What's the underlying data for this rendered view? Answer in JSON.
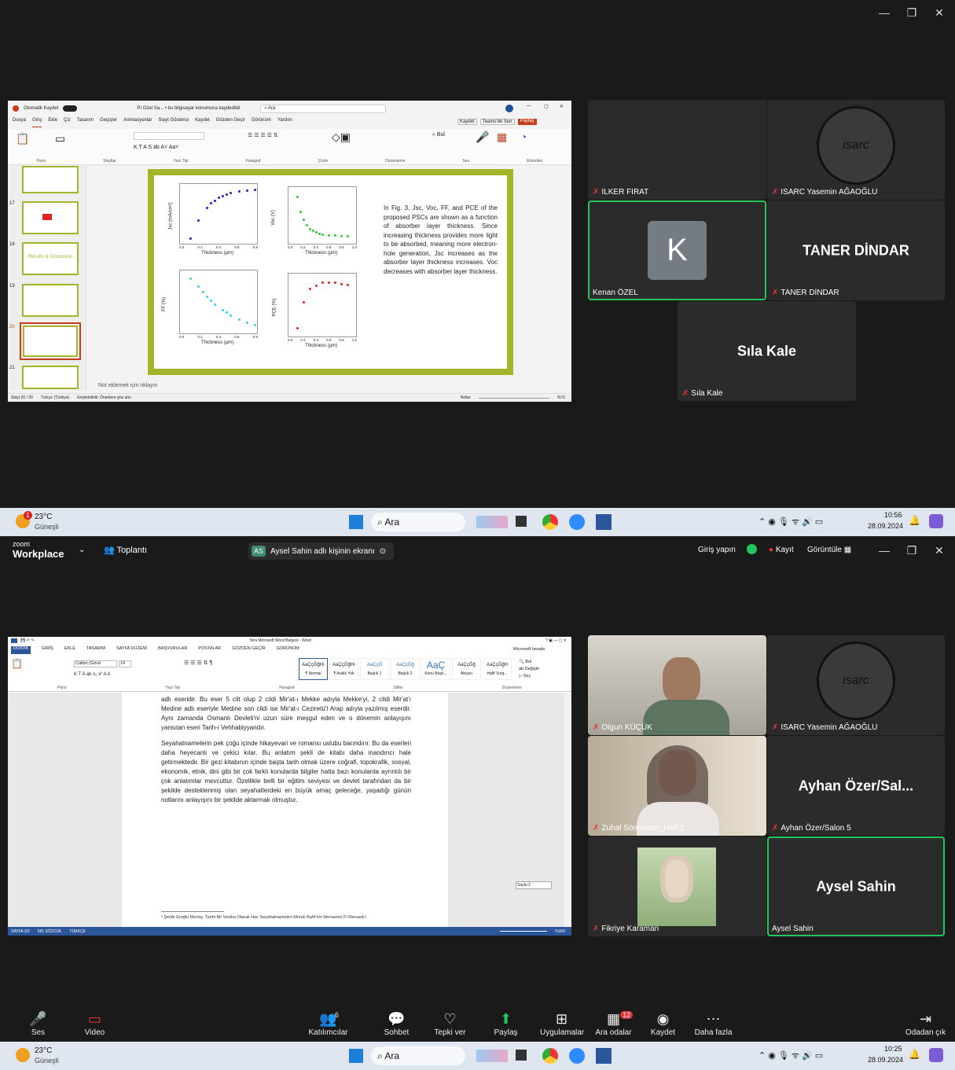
{
  "top_window": {
    "controls": [
      "—",
      "❐",
      "✕"
    ]
  },
  "ppt": {
    "autosave_label": "Otomatik Kaydet",
    "title": "PI Ozel Sa... • bu bilgisayar konumuna kaydedildi",
    "search": "Ara",
    "menu": [
      "Dosya",
      "Giriş",
      "Ekle",
      "Çiz",
      "Tasarım",
      "Geçişler",
      "Animasyonlar",
      "Slayt Gösterisi",
      "Kaydet",
      "Gözden Geçir",
      "Görünüm",
      "Yardım"
    ],
    "right_buttons": [
      "Kaydet",
      "Teams'de Sun",
      "Paylaş"
    ],
    "groups": [
      "Pano",
      "Slaytlar",
      "Yazı Tipi",
      "Paragraf",
      "Çizim",
      "Düzenleme",
      "Ses",
      "Eklentiler"
    ],
    "thumb_numbers": [
      "17",
      "18",
      "19",
      "20",
      "21"
    ],
    "thumb_18_text": "Results & Discussion",
    "notes": "Not eklemek için tıklayın",
    "status_left": "Slayt 20 / 30",
    "status_lang": "Türkçe (Türkiye)",
    "status_access": "Erişilebilirlik: Önerilere göz atın",
    "status_notes": "Notlar",
    "status_zoom": "%70",
    "slide_text": "In Fig. 3, Jsc, Voc, FF, and PCE of the proposed PSCs are shown as a function of absorber layer thickness. Since increasing thickness provides more light to be absorbed, meaning more electron-hole generation, Jsc increases as the absorber layer thickness increases. Voc decreases with absorber layer thickness."
  },
  "chart_data": [
    {
      "type": "scatter",
      "xlabel": "Thickness (μm)",
      "ylabel": "Jsc (mA/cm²)",
      "x": [
        0.1,
        0.2,
        0.3,
        0.35,
        0.4,
        0.45,
        0.5,
        0.55,
        0.6,
        0.7,
        0.8,
        0.9
      ],
      "y": [
        14,
        20,
        24,
        25.5,
        26.5,
        27.5,
        28,
        28.5,
        29,
        29.5,
        29.8,
        30
      ],
      "color": "#1c1cd8",
      "xticks": [
        "0.0",
        "0.2",
        "0.4",
        "0.6",
        "0.8"
      ]
    },
    {
      "type": "scatter",
      "xlabel": "Thickness (μm)",
      "ylabel": "Voc (V)",
      "x": [
        0.1,
        0.15,
        0.2,
        0.25,
        0.3,
        0.35,
        0.4,
        0.45,
        0.5,
        0.6,
        0.7,
        0.8,
        0.9
      ],
      "y": [
        0.95,
        0.91,
        0.89,
        0.875,
        0.865,
        0.86,
        0.855,
        0.852,
        0.85,
        0.848,
        0.846,
        0.845,
        0.844
      ],
      "color": "#2ecc2e",
      "xticks": [
        "0.0",
        "0.2",
        "0.4",
        "0.6",
        "0.8",
        "1.0"
      ]
    },
    {
      "type": "scatter",
      "xlabel": "Thickness (μm)",
      "ylabel": "FF (%)",
      "x": [
        0.1,
        0.2,
        0.25,
        0.3,
        0.35,
        0.4,
        0.5,
        0.55,
        0.6,
        0.7,
        0.8,
        0.9
      ],
      "y": [
        86,
        84.5,
        83.5,
        82.5,
        81.8,
        81,
        80,
        79.5,
        79,
        78.3,
        77.7,
        77.2
      ],
      "color": "#33d4e8",
      "xticks": [
        "0.0",
        "0.2",
        "0.4",
        "0.6",
        "0.8"
      ]
    },
    {
      "type": "scatter",
      "xlabel": "Thickness (μm)",
      "ylabel": "PCE (%)",
      "x": [
        0.1,
        0.2,
        0.3,
        0.4,
        0.5,
        0.6,
        0.7,
        0.8,
        0.9
      ],
      "y": [
        14,
        18,
        20,
        20.5,
        21,
        21,
        21,
        20.8,
        20.7
      ],
      "color": "#e02020",
      "xticks": [
        "0.0",
        "0.2",
        "0.4",
        "0.6",
        "0.8",
        "1.0"
      ]
    }
  ],
  "top_tiles": [
    {
      "name": "ILKER FIRAT"
    },
    {
      "name": "ISARC Yasemin AĞAOĞLU",
      "logo": "isarc"
    },
    {
      "name": "Kenan ÖZEL",
      "initial": "K"
    },
    {
      "name": "TANER DİNDAR",
      "big": "TANER DİNDAR"
    },
    {
      "name": "Sıla Kale",
      "big": "Sıla Kale"
    }
  ],
  "taskbar_top": {
    "temp": "23°C",
    "weather": "Güneşli",
    "search": "Ara",
    "time": "10:56",
    "date": "28.09.2024",
    "badge": "1"
  },
  "zoom": {
    "brand1": "zoom",
    "brand2": "Workplace",
    "meeting": "Toplantı",
    "share_tag": "AS",
    "share_label": "Aysel Sahin adlı kişinin ekranı",
    "signin": "Giriş yapın",
    "record": "Kayıt",
    "view": "Görüntüle"
  },
  "word": {
    "title": "Yeni Microsoft Word Belgesi - Word",
    "account": "Microsoft hesabı",
    "menu": [
      "DOSYA",
      "GİRİŞ",
      "EKLE",
      "TASARIM",
      "SAYFA DÜZENİ",
      "BAŞVURULAR",
      "POSTALAR",
      "GÖZDEN GEÇİR",
      "GÖRÜNÜM"
    ],
    "font": "Calibri (Gövd",
    "size": "14",
    "styles": [
      "¶ Normal",
      "¶ Aralık Yok",
      "Başlık 1",
      "Başlık 2",
      "Konu Başlı...",
      "Altyazı",
      "Hafif Vurg..."
    ],
    "style_previews": [
      "AaÇçĞğHı",
      "AaÇçĞğHı",
      "AaÇçĞ",
      "AaÇçĞğ",
      "AaÇ",
      "AaÇçĞğ",
      "AaÇçĞğH"
    ],
    "groups": [
      "Pano",
      "Yazı Tipi",
      "Paragraf",
      "Stiller",
      "Düzenleme"
    ],
    "para1": "adlı eseridir. Bu eser 5 cilt olup 2 cildi Mir'at-ı Mekke adıyla Mekke'yi, 2 cildi Mir'at'ı Medine adlı eseriyle Medine son cildi ise Mir'at-ı Ceziretü'l Arap adıyla yazılmış eserdir. Aynı zamanda Osmanlı Devleti'ni uzun süre meşgul eden ve o dönemin anlayışını yansıtan eseri Tarih-i Vehhabiyyandır.",
    "para2": "Seyahatnamelerin pek çoğu içinde hikayevari ve romansı uslubu barındırır. Bu da eserleri daha heyecanlı ve çekici kılar. Bu anlatım şekli de kitabı daha inandırıcı hale getirmektedir. Bir gezi kitabının içinde başta tarih olmak üzere coğrafi, topokrafik, sosyal, ekonomik, etnik, dini gibi bir çok farklı konularda bilgiler hatta bazı konularda ayrıntılı bir çok anlatımlar mevcuttur. Özellikle belli bir eğitim seviyesi ve devlet tarafından da bir şekilde desteklenmiş olan seyahatlerdeki en büyük amaç geleceğe, yaşadığı günün notlarını anlayışını bir şekilde aktarmak olmuştur.",
    "footnote": "³ Şerife Eroğlu Memiş, Tarihi Bir Vesika Olarak Hac Seyahatnameleri Moralı Baht'nin Menasme Fi Menasik'i",
    "page_tag": "Sayfa 2",
    "status": [
      "SAYFA 2/2",
      "581 SÖZCÜK",
      "TÜRKÇE"
    ],
    "zoom": "%100"
  },
  "bottom_tiles": [
    {
      "name": "Olgun KÜÇÜK"
    },
    {
      "name": "ISARC Yasemin AĞAOĞLU",
      "logo": "isarc"
    },
    {
      "name": "Zuhal Sönmezer_Hall-2"
    },
    {
      "name": "Ayhan Özer/Salon 5",
      "big": "Ayhan Özer/Sal..."
    },
    {
      "name": "Fikriye Karaman"
    },
    {
      "name": "Aysel Sahin",
      "big": "Aysel Sahin"
    }
  ],
  "controls": [
    {
      "label": "Ses",
      "icon": "mic-muted-icon"
    },
    {
      "label": "Video",
      "icon": "video-off-icon"
    },
    {
      "label": "Katılımcılar",
      "icon": "participants-icon",
      "count": "6"
    },
    {
      "label": "Sohbet",
      "icon": "chat-icon"
    },
    {
      "label": "Tepki ver",
      "icon": "heart-icon"
    },
    {
      "label": "Paylaş",
      "icon": "share-icon"
    },
    {
      "label": "Uygulamalar",
      "icon": "apps-icon"
    },
    {
      "label": "Ara odalar",
      "icon": "breakout-icon",
      "count": "12"
    },
    {
      "label": "Kaydet",
      "icon": "record-icon"
    },
    {
      "label": "Daha fazla",
      "icon": "more-icon"
    },
    {
      "label": "Odadan çık",
      "icon": "leave-icon"
    }
  ],
  "taskbar_bottom": {
    "temp": "23°C",
    "weather": "Güneşli",
    "search": "Ara",
    "time": "10:25",
    "date": "28.09.2024"
  },
  "isarc_text": "isarc",
  "colors": {
    "accent_green": "#22c55e",
    "ppt_red": "#c43e1c",
    "word_blue": "#2b579a",
    "slide_border": "#a5b52b"
  }
}
